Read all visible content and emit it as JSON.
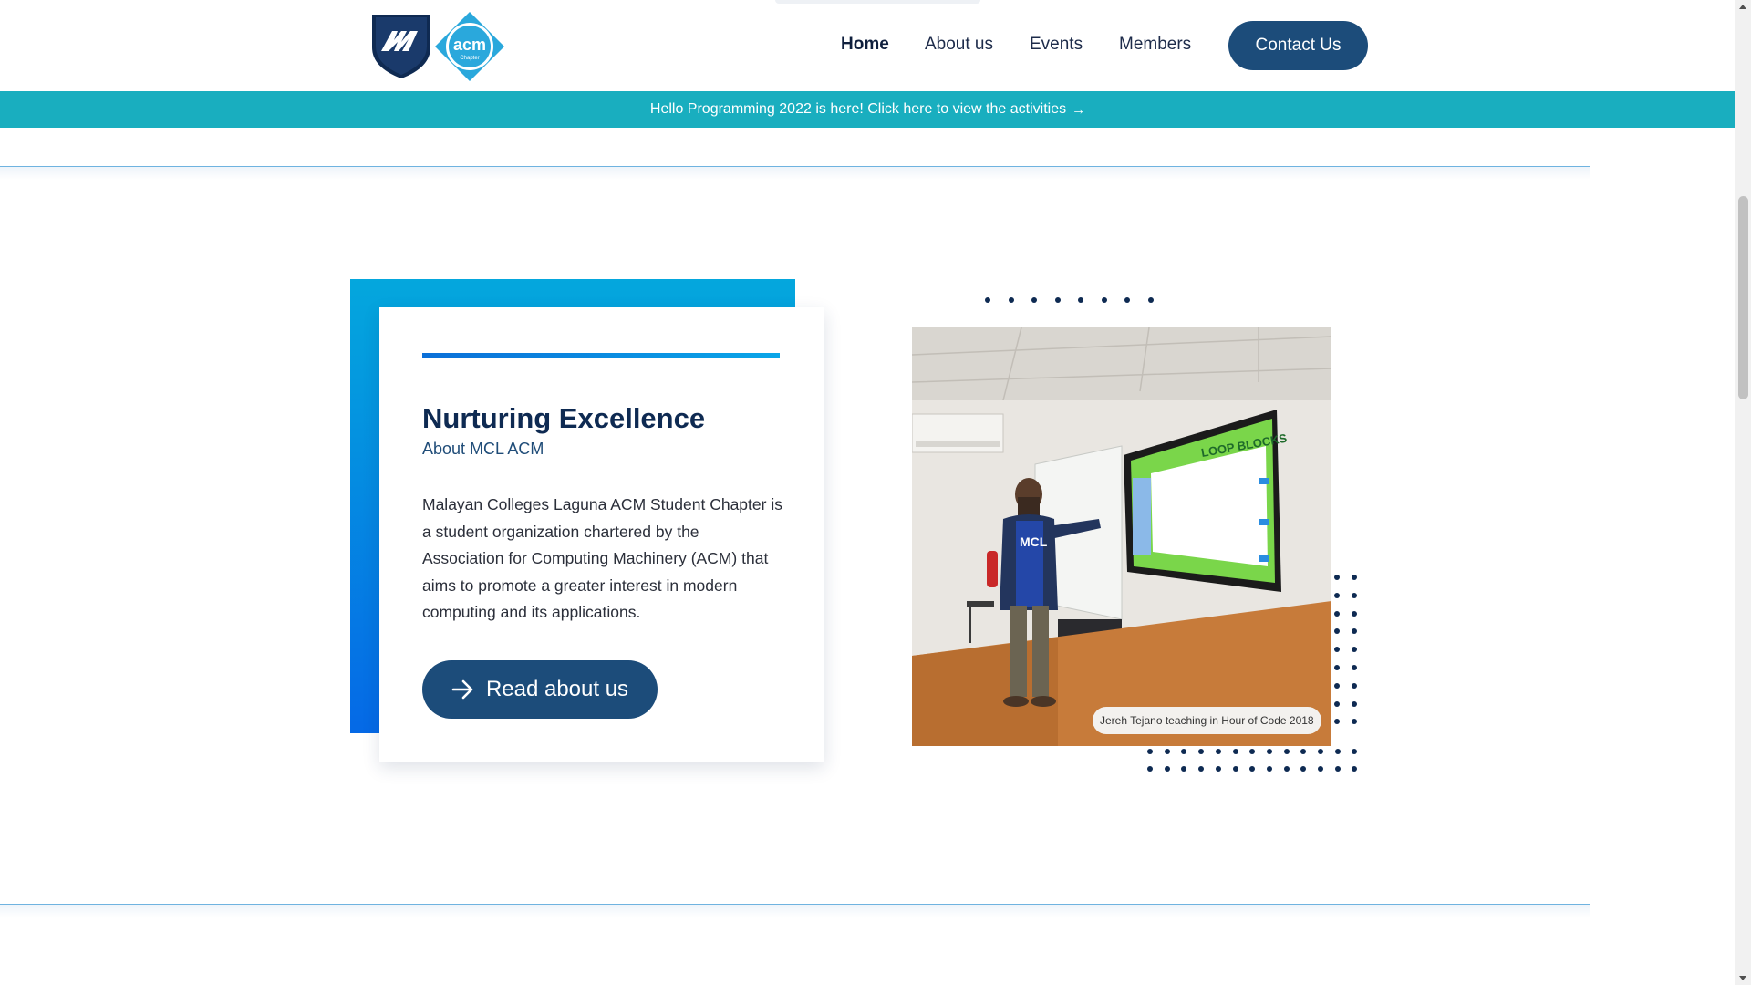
{
  "nav": {
    "items": [
      {
        "label": "Home",
        "active": true
      },
      {
        "label": "About us",
        "active": false
      },
      {
        "label": "Events",
        "active": false
      },
      {
        "label": "Members",
        "active": false
      }
    ],
    "contact_label": "Contact Us",
    "logo_text": "acm",
    "logo_subtext": "Chapter"
  },
  "announcement": {
    "text": "Hello Programming 2022 is here! Click here to view the activities",
    "icon": "arrow-right-icon"
  },
  "about": {
    "title": "Nurturing Excellence",
    "subtitle": "About MCL ACM",
    "body": "Malayan Colleges Laguna ACM Student Chapter is a student organization chartered by the Association for Computing Machinery (ACM) that aims to promote a greater interest in modern computing and its applications.",
    "button_label": "Read about us",
    "button_icon": "arrow-right-icon"
  },
  "photo": {
    "caption": "Jereh Tejano teaching in Hour of Code 2018",
    "screen_text": "LOOP BLOCKS",
    "shirt_text": "MCL"
  },
  "colors": {
    "primary": "#1c4c7a",
    "announce": "#19aebf",
    "accent_gradient_top": "#04a7dd",
    "accent_gradient_bottom": "#0569e6",
    "dot": "#0e2a52"
  }
}
